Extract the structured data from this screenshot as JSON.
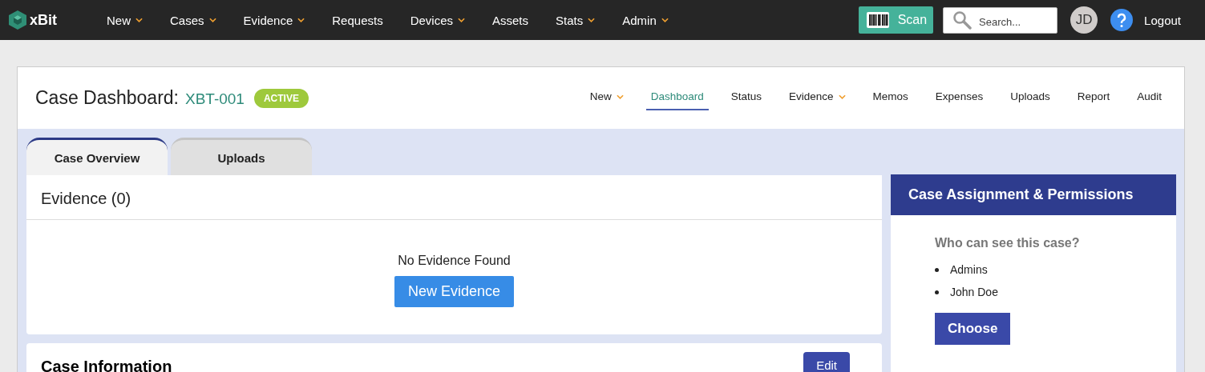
{
  "topbar": {
    "brand": "xBit",
    "menu": [
      {
        "label": "New",
        "dropdown": true
      },
      {
        "label": "Cases",
        "dropdown": true
      },
      {
        "label": "Evidence",
        "dropdown": true
      },
      {
        "label": "Requests",
        "dropdown": false
      },
      {
        "label": "Devices",
        "dropdown": true
      },
      {
        "label": "Assets",
        "dropdown": false
      },
      {
        "label": "Stats",
        "dropdown": true
      },
      {
        "label": "Admin",
        "dropdown": true
      }
    ],
    "scan": "Scan",
    "search": {
      "placeholder": "Search..."
    },
    "avatar": "JD",
    "logout": "Logout"
  },
  "header": {
    "title": "Case Dashboard:",
    "case_id": "XBT-001",
    "status": "ACTIVE",
    "nav": [
      {
        "label": "New",
        "dropdown": true,
        "selected": false
      },
      {
        "label": "Dashboard",
        "dropdown": false,
        "selected": true
      },
      {
        "label": "Status",
        "dropdown": false,
        "selected": false
      },
      {
        "label": "Evidence",
        "dropdown": true,
        "selected": false
      },
      {
        "label": "Memos",
        "dropdown": false,
        "selected": false
      },
      {
        "label": "Expenses",
        "dropdown": false,
        "selected": false
      },
      {
        "label": "Uploads",
        "dropdown": false,
        "selected": false
      },
      {
        "label": "Report",
        "dropdown": false,
        "selected": false
      },
      {
        "label": "Audit",
        "dropdown": false,
        "selected": false
      }
    ]
  },
  "tabs": [
    {
      "label": "Case Overview",
      "selected": true
    },
    {
      "label": "Uploads",
      "selected": false
    }
  ],
  "evidence": {
    "title": "Evidence (0)",
    "empty": "No Evidence Found",
    "button": "New Evidence"
  },
  "case_info": {
    "title": "Case Information",
    "button": "Edit"
  },
  "permissions": {
    "title": "Case Assignment & Permissions",
    "question": "Who can see this case?",
    "people": [
      "Admins",
      "John Doe"
    ],
    "button": "Choose"
  }
}
